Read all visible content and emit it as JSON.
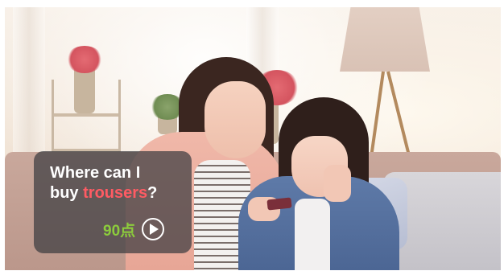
{
  "quiz_card": {
    "question_part1": "Where can I",
    "question_part2": "buy ",
    "question_highlight": "trousers",
    "question_end": "?",
    "score": "90点",
    "play_icon": "play-icon"
  },
  "colors": {
    "highlight": "#ff5b63",
    "score": "#8ccc3c",
    "card_background": "rgba(60,60,64,0.72)"
  }
}
